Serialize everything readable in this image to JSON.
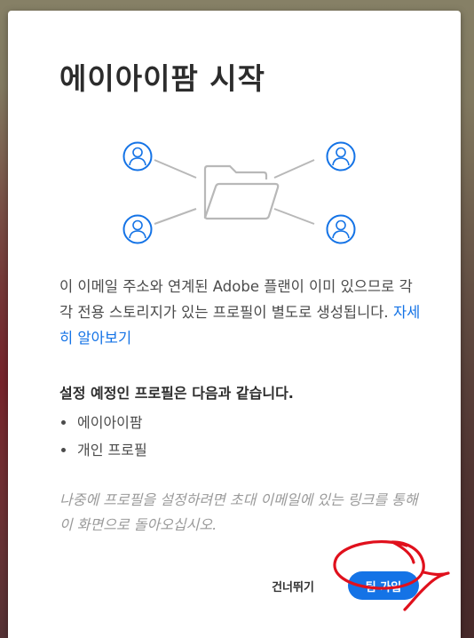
{
  "dialog": {
    "title": "에이아이팜 시작",
    "description": "이 이메일 주소와 연계된 Adobe 플랜이 이미 있으므로 각각 전용 스토리지가 있는 프로필이 별도로 생성됩니다.",
    "learn_more_link": "자세히 알아보기",
    "profiles_heading": "설정 예정인 프로필은 다음과 같습니다.",
    "profiles": [
      {
        "label": "에이아이팜"
      },
      {
        "label": "개인 프로필"
      }
    ],
    "note": "나중에 프로필을 설정하려면 초대 이메일에 있는 링크를 통해 이 화면으로 돌아오십시오.",
    "skip_label": "건너뛰기",
    "join_label": "팀 가입"
  },
  "colors": {
    "accent": "#1473e6",
    "title_text": "#2c2c2c",
    "body_text": "#4b4b4b",
    "note_text": "#9a9a9a",
    "illustration_stroke": "#b8b8b8",
    "annotation": "#e0101c"
  },
  "icons": {
    "user": "user-avatar-icon",
    "folder": "folder-icon"
  }
}
